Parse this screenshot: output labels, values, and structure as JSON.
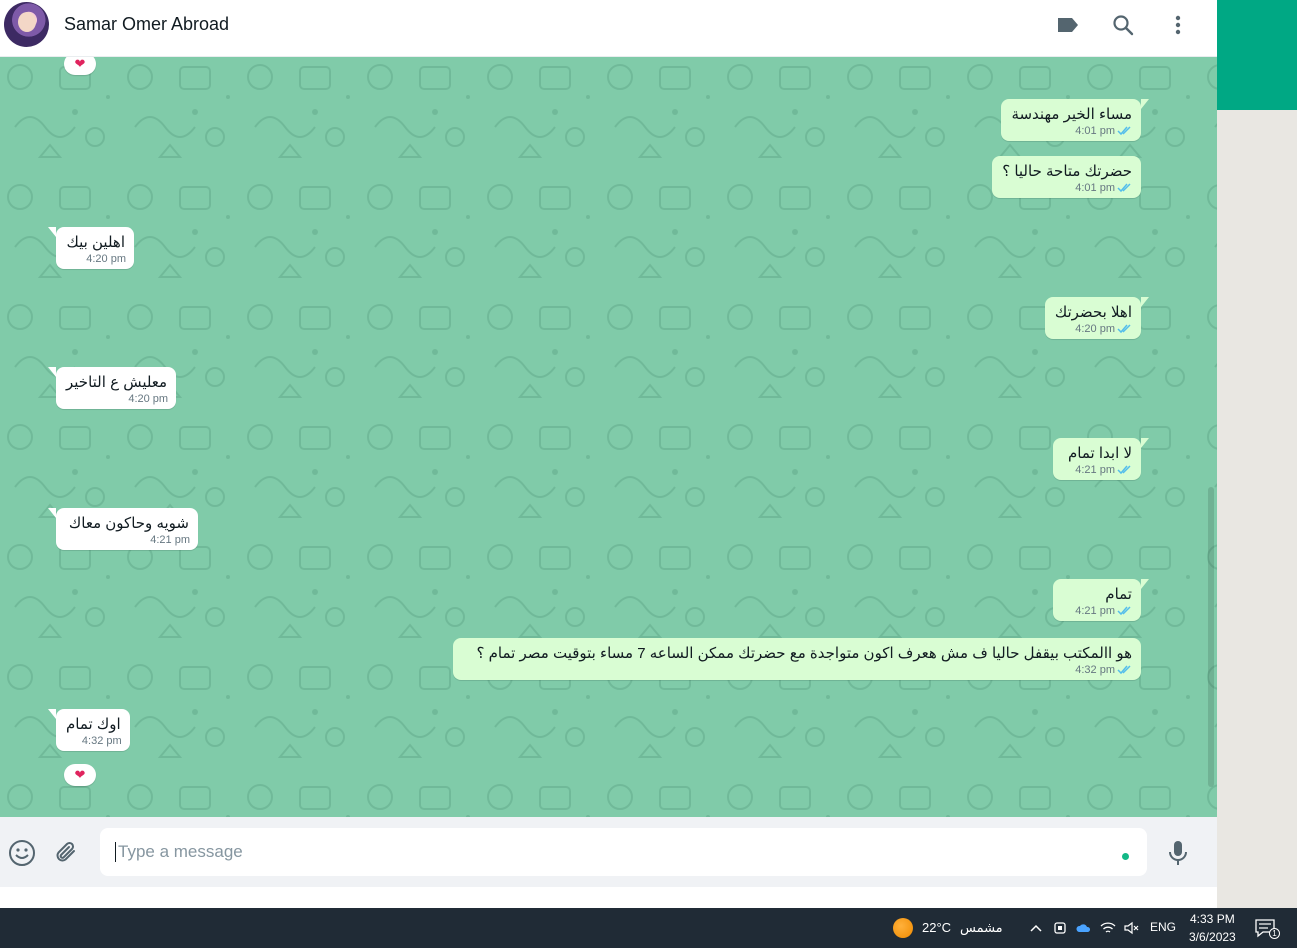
{
  "header": {
    "contact_name": "Samar Omer Abroad",
    "icons": [
      "label-icon",
      "search-icon",
      "more-vert-icon"
    ]
  },
  "messages": [
    {
      "dir": "out",
      "text": "مساء الخير مهندسة",
      "time": "4:01 pm",
      "status": "read"
    },
    {
      "dir": "out",
      "text": "حضرتك متاحة حاليا ؟",
      "time": "4:01 pm",
      "status": "read"
    },
    {
      "dir": "in",
      "text": "اهلين بيك",
      "time": "4:20 pm"
    },
    {
      "dir": "out",
      "text": "اهلا بحضرتك",
      "time": "4:20 pm",
      "status": "read"
    },
    {
      "dir": "in",
      "text": "معليش ع التاخير",
      "time": "4:20 pm"
    },
    {
      "dir": "out",
      "text": "لا ابدا تمام",
      "time": "4:21 pm",
      "status": "read"
    },
    {
      "dir": "in",
      "text": "شويه وحاكون معاك",
      "time": "4:21 pm"
    },
    {
      "dir": "out",
      "text": "تمام",
      "time": "4:21 pm",
      "status": "read"
    },
    {
      "dir": "out",
      "text": "هو االمكتب بيقفل حاليا ف مش هعرف اكون متواجدة مع حضرتك ممكن الساعه 7 مساء بتوقيت مصر تمام ؟",
      "time": "4:32 pm",
      "status": "read"
    },
    {
      "dir": "in",
      "text": "اوك تمام",
      "time": "4:32 pm",
      "reaction": "❤"
    }
  ],
  "top_reaction": "❤",
  "composer": {
    "placeholder": "Type a message",
    "icons": [
      "emoji-icon",
      "attach-icon",
      "mic-icon"
    ]
  },
  "taskbar": {
    "weather_temp": "22°C",
    "weather_text": "مشمس",
    "language": "ENG",
    "time": "4:33 PM",
    "date": "3/6/2023",
    "notification_count": "1"
  },
  "colors": {
    "chat_bg": "#80cba9",
    "outgoing_bubble": "#d9fdd3",
    "incoming_bubble": "#ffffff",
    "read_ticks": "#53bdeb",
    "accent": "#00a884"
  }
}
